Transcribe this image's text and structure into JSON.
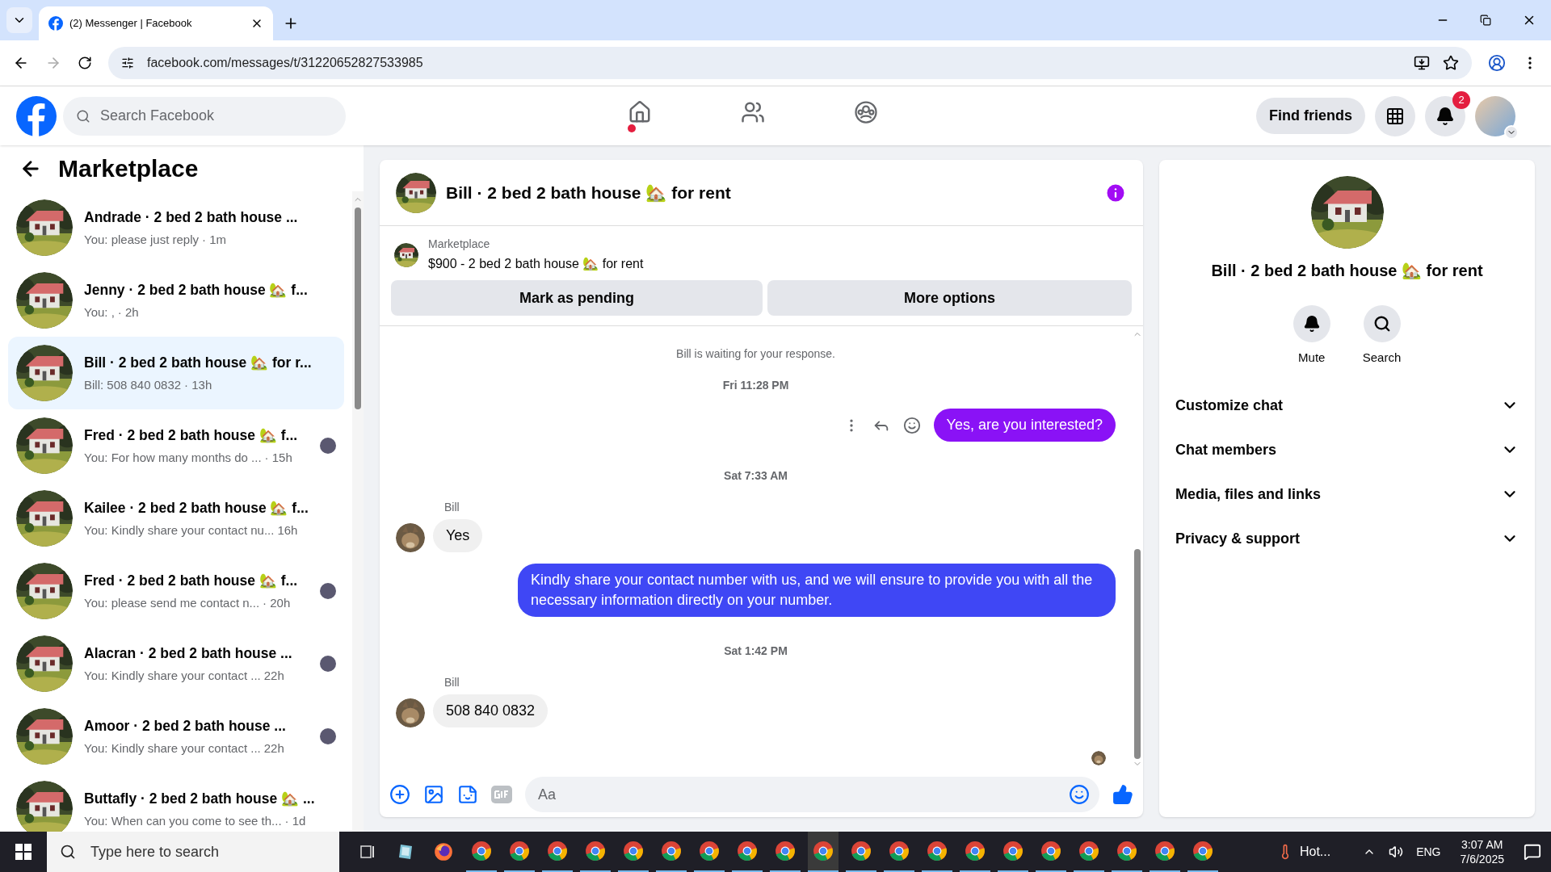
{
  "browser": {
    "tabs": [
      {
        "title": "(2) Messenger | Facebook",
        "selected": true
      }
    ],
    "url": "facebook.com/messages/t/31220652827533985"
  },
  "header": {
    "search_placeholder": "Search Facebook",
    "find_friends": "Find friends",
    "notification_count": "2"
  },
  "sidebar": {
    "title": "Marketplace",
    "conversations": [
      {
        "title": "Andrade · 2 bed 2 bath house ...",
        "preview": "You: please just reply",
        "time": "· 1m",
        "selected": false,
        "seen": false
      },
      {
        "title": "Jenny · 2 bed 2 bath house 🏡 f...",
        "preview": "You: ,",
        "time": "· 2h",
        "selected": false,
        "seen": false
      },
      {
        "title": "Bill · 2 bed 2 bath house 🏡 for r...",
        "preview": "Bill: 508 840 0832",
        "time": "· 13h",
        "selected": true,
        "seen": false
      },
      {
        "title": "Fred · 2 bed 2 bath house 🏡 f...",
        "preview": "You: For how many months do ...",
        "time": "· 15h",
        "selected": false,
        "seen": true
      },
      {
        "title": "Kailee · 2 bed 2 bath house 🏡 f...",
        "preview": "You: Kindly share your contact nu...",
        "time": "16h",
        "selected": false,
        "seen": false
      },
      {
        "title": "Fred · 2 bed 2 bath house 🏡 f...",
        "preview": "You: please send me contact n...",
        "time": "· 20h",
        "selected": false,
        "seen": true
      },
      {
        "title": "Alacran · 2 bed 2 bath house ...",
        "preview": "You: Kindly share your contact ...",
        "time": "22h",
        "selected": false,
        "seen": true
      },
      {
        "title": "Amoor · 2 bed 2 bath house ...",
        "preview": "You: Kindly share your contact ...",
        "time": "22h",
        "selected": false,
        "seen": true
      },
      {
        "title": "Buttafly · 2 bed 2 bath house 🏡 ...",
        "preview": "You: When can you come to see th...",
        "time": "· 1d",
        "selected": false,
        "seen": false
      }
    ]
  },
  "chat": {
    "title": "Bill · 2 bed 2 bath house 🏡 for rent",
    "listing": {
      "label": "Marketplace",
      "text": "$900 - 2 bed 2 bath house 🏡 for rent"
    },
    "buttons": [
      "Mark as pending",
      "More options"
    ],
    "notice": "Bill is waiting for your response.",
    "messages": [
      {
        "kind": "timestamp",
        "text": "Fri 11:28 PM"
      },
      {
        "kind": "outgoing",
        "text": "Yes, are you interested?",
        "color": "#8a12f6",
        "actions": true
      },
      {
        "kind": "timestamp",
        "text": "Sat 7:33 AM"
      },
      {
        "kind": "incoming",
        "sender": "Bill",
        "text": "Yes"
      },
      {
        "kind": "outgoing",
        "text": "Kindly share your contact number with us, and we will ensure to provide you with all the necessary information directly on your number.",
        "color": "#3f47f5",
        "actions": false
      },
      {
        "kind": "timestamp",
        "text": "Sat 1:42 PM"
      },
      {
        "kind": "incoming",
        "sender": "Bill",
        "text": "508 840 0832"
      }
    ],
    "composer_placeholder": "Aa"
  },
  "details": {
    "title": "Bill · 2 bed 2 bath house 🏡 for rent",
    "actions": [
      {
        "kind": "mute",
        "label": "Mute"
      },
      {
        "kind": "search",
        "label": "Search"
      }
    ],
    "sections": [
      {
        "label": "Customize chat",
        "expanded": false
      },
      {
        "label": "Chat members",
        "expanded": false
      },
      {
        "label": "Media, files and links",
        "expanded": false
      },
      {
        "label": "Privacy & support",
        "expanded": false
      }
    ]
  },
  "taskbar": {
    "search_placeholder": "Type here to search",
    "apps": [
      {
        "kind": "taskview",
        "selected": false
      },
      {
        "kind": "notes",
        "selected": false
      },
      {
        "kind": "firefox",
        "selected": false
      },
      {
        "kind": "chrome",
        "selected": false
      },
      {
        "kind": "chrome",
        "selected": false
      },
      {
        "kind": "chrome",
        "selected": false
      },
      {
        "kind": "chrome",
        "selected": false
      },
      {
        "kind": "chrome",
        "selected": false
      },
      {
        "kind": "chrome",
        "selected": false
      },
      {
        "kind": "chrome",
        "selected": false
      },
      {
        "kind": "chrome",
        "selected": false
      },
      {
        "kind": "chrome",
        "selected": false
      },
      {
        "kind": "chrome",
        "selected": true
      },
      {
        "kind": "chrome",
        "selected": false
      },
      {
        "kind": "chrome",
        "selected": false
      },
      {
        "kind": "chrome",
        "selected": false
      },
      {
        "kind": "chrome",
        "selected": false
      },
      {
        "kind": "chrome",
        "selected": false
      },
      {
        "kind": "chrome",
        "selected": false
      },
      {
        "kind": "chrome",
        "selected": false
      },
      {
        "kind": "chrome",
        "selected": false
      },
      {
        "kind": "chrome",
        "selected": false
      },
      {
        "kind": "chrome",
        "selected": false
      }
    ],
    "weather": "Hot...",
    "language": "ENG",
    "time": "3:07 AM",
    "date": "7/6/2025"
  }
}
